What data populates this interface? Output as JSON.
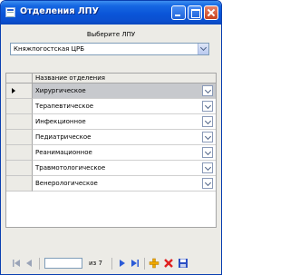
{
  "window": {
    "title": "Отделения ЛПУ"
  },
  "filter": {
    "caption": "Выберите ЛПУ",
    "selected": "Княжпогостская ЦРБ"
  },
  "grid": {
    "column_header": "Название отделения",
    "rows": [
      "Хирургическое",
      "Терапевтическое",
      "Инфекционное",
      "Педиатрическое",
      "Реанимационное",
      "Травмотологическое",
      "Венерологическое"
    ],
    "selected_row": 0
  },
  "navigator": {
    "position": "",
    "count": "из 7"
  },
  "icons": {
    "window": "app-icon",
    "nav": [
      "first-record-icon",
      "prev-record-icon",
      "next-record-icon",
      "last-record-icon"
    ],
    "actions": [
      "add-icon",
      "delete-icon",
      "save-icon"
    ]
  },
  "colors": {
    "titlebar": "#0a55d8",
    "selected_row": "#c7c9cd",
    "add": "#f0a800",
    "delete": "#e02020",
    "save": "#2b4fc4"
  }
}
